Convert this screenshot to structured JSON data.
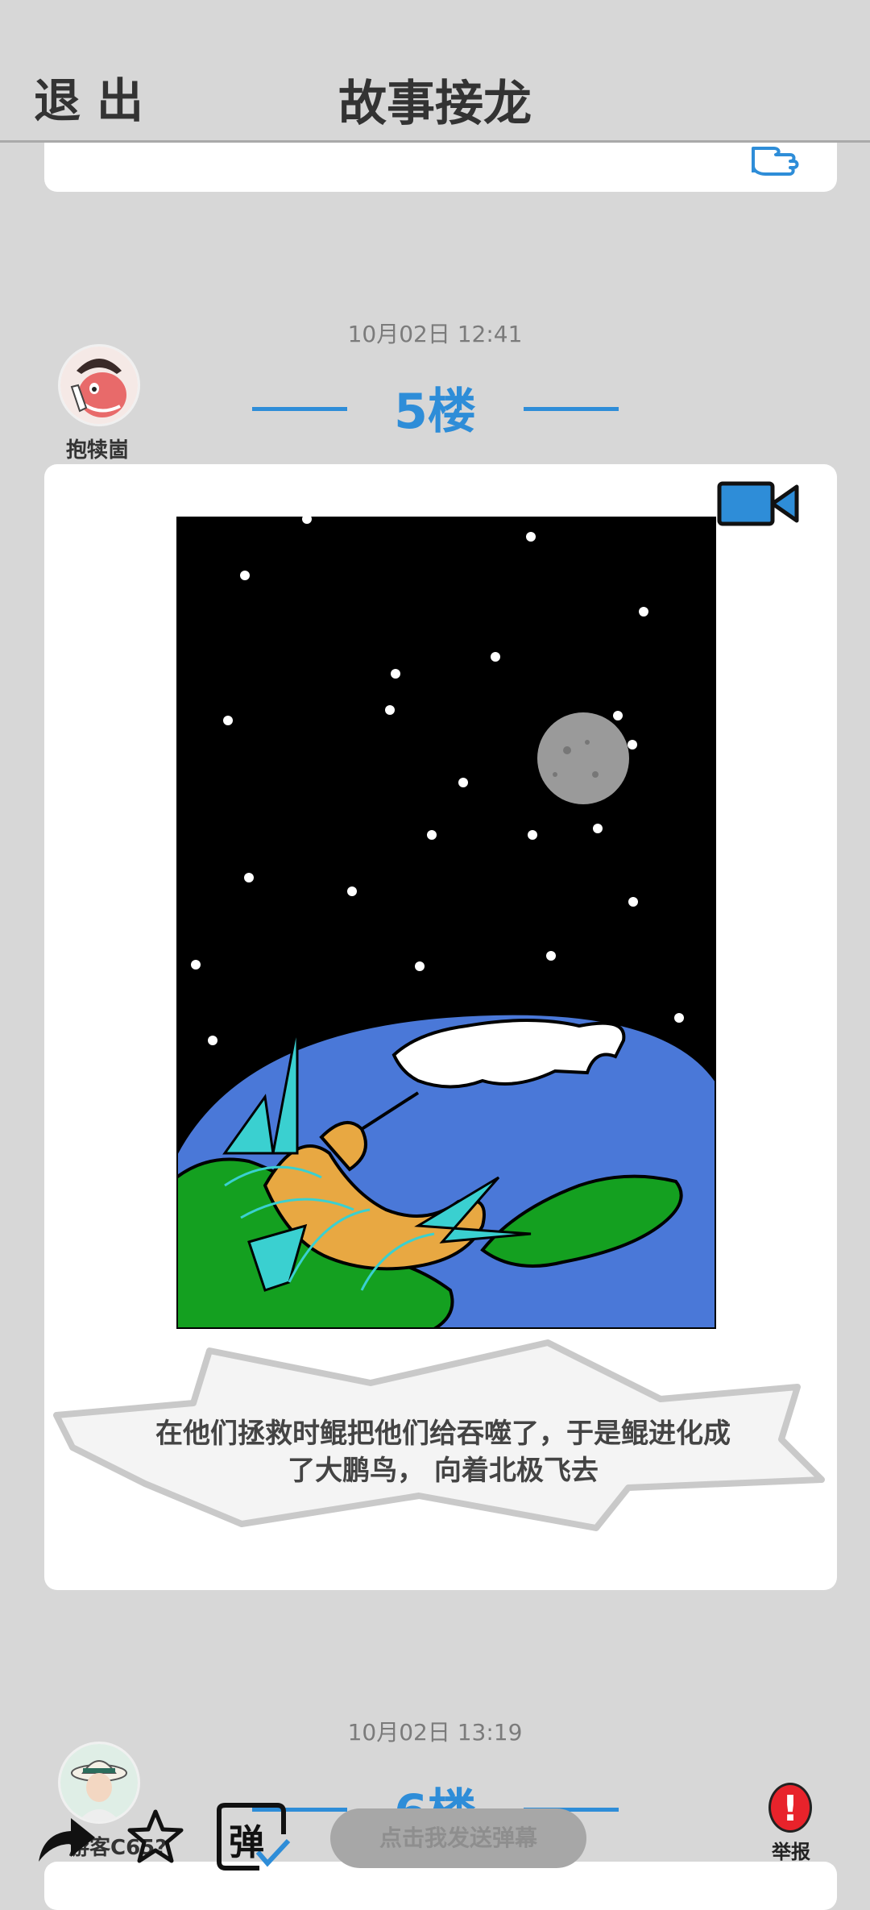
{
  "header": {
    "exit_label": "退出",
    "title": "故事接龙"
  },
  "post5": {
    "timestamp": "10月02日  12:41",
    "floor": "5楼",
    "user_name": "抱犊崮",
    "caption": "在他们拯救时鲲把他们给吞噬了，于是鲲进化成了大鹏鸟， 向着北极飞去"
  },
  "post6": {
    "timestamp": "10月02日  13:19",
    "floor": "6楼",
    "user_name": "游客C65?"
  },
  "toolbar": {
    "danmu_placeholder": "点击我发送弹幕",
    "danmu_icon_char": "弹",
    "report_label": "举报",
    "report_mark": "!"
  },
  "colors": {
    "accent": "#2e8dd8",
    "background": "#d7d7d7",
    "report": "#e8232b"
  },
  "icons": [
    "thumbs-up-icon",
    "video-camera-icon",
    "share-icon",
    "star-icon",
    "danmu-icon",
    "report-icon"
  ]
}
